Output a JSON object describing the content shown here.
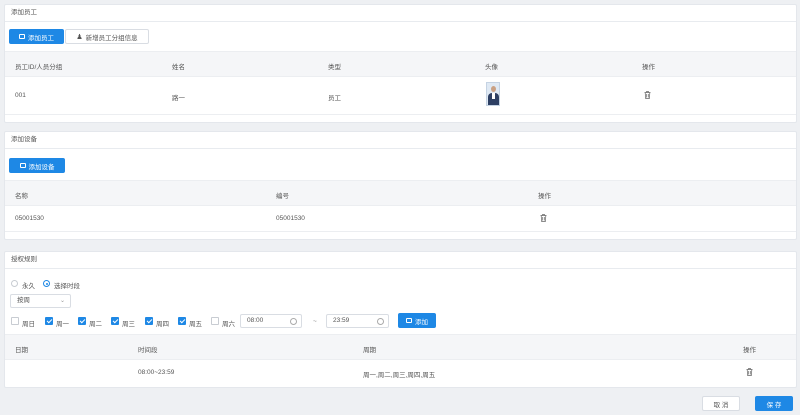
{
  "staff": {
    "title": "添加员工",
    "add_button": "添加员工",
    "group_button": "新增员工分组信息",
    "columns": [
      "员工ID/人员分组",
      "姓名",
      "类型",
      "头像",
      "操作"
    ],
    "rows": [
      {
        "id": "001",
        "name": "路一",
        "type": "员工"
      }
    ]
  },
  "device": {
    "title": "添加设备",
    "add_button": "添加设备",
    "columns": [
      "名称",
      "编号",
      "操作"
    ],
    "rows": [
      {
        "name": "05001530",
        "code": "05001530"
      }
    ]
  },
  "rules": {
    "title": "授权规则",
    "radio_forever": "永久",
    "radio_select": "选择时段",
    "select_value": "按周",
    "weekdays": [
      {
        "label": "周日",
        "checked": false
      },
      {
        "label": "周一",
        "checked": true
      },
      {
        "label": "周二",
        "checked": true
      },
      {
        "label": "周三",
        "checked": true
      },
      {
        "label": "周四",
        "checked": true
      },
      {
        "label": "周五",
        "checked": true
      },
      {
        "label": "周六",
        "checked": false
      }
    ],
    "start_time": "08:00",
    "tilde": "~",
    "end_time": "23:59",
    "add_button": "添加",
    "columns": [
      "日期",
      "时间段",
      "周期",
      "操作"
    ],
    "rows": [
      {
        "date": "",
        "period": "08:00~23:59",
        "cycle": "周一,周二,周三,周四,周五"
      }
    ]
  },
  "footer": {
    "cancel": "取 消",
    "save": "保 存"
  },
  "colors": {
    "primary": "#1e88e5"
  }
}
